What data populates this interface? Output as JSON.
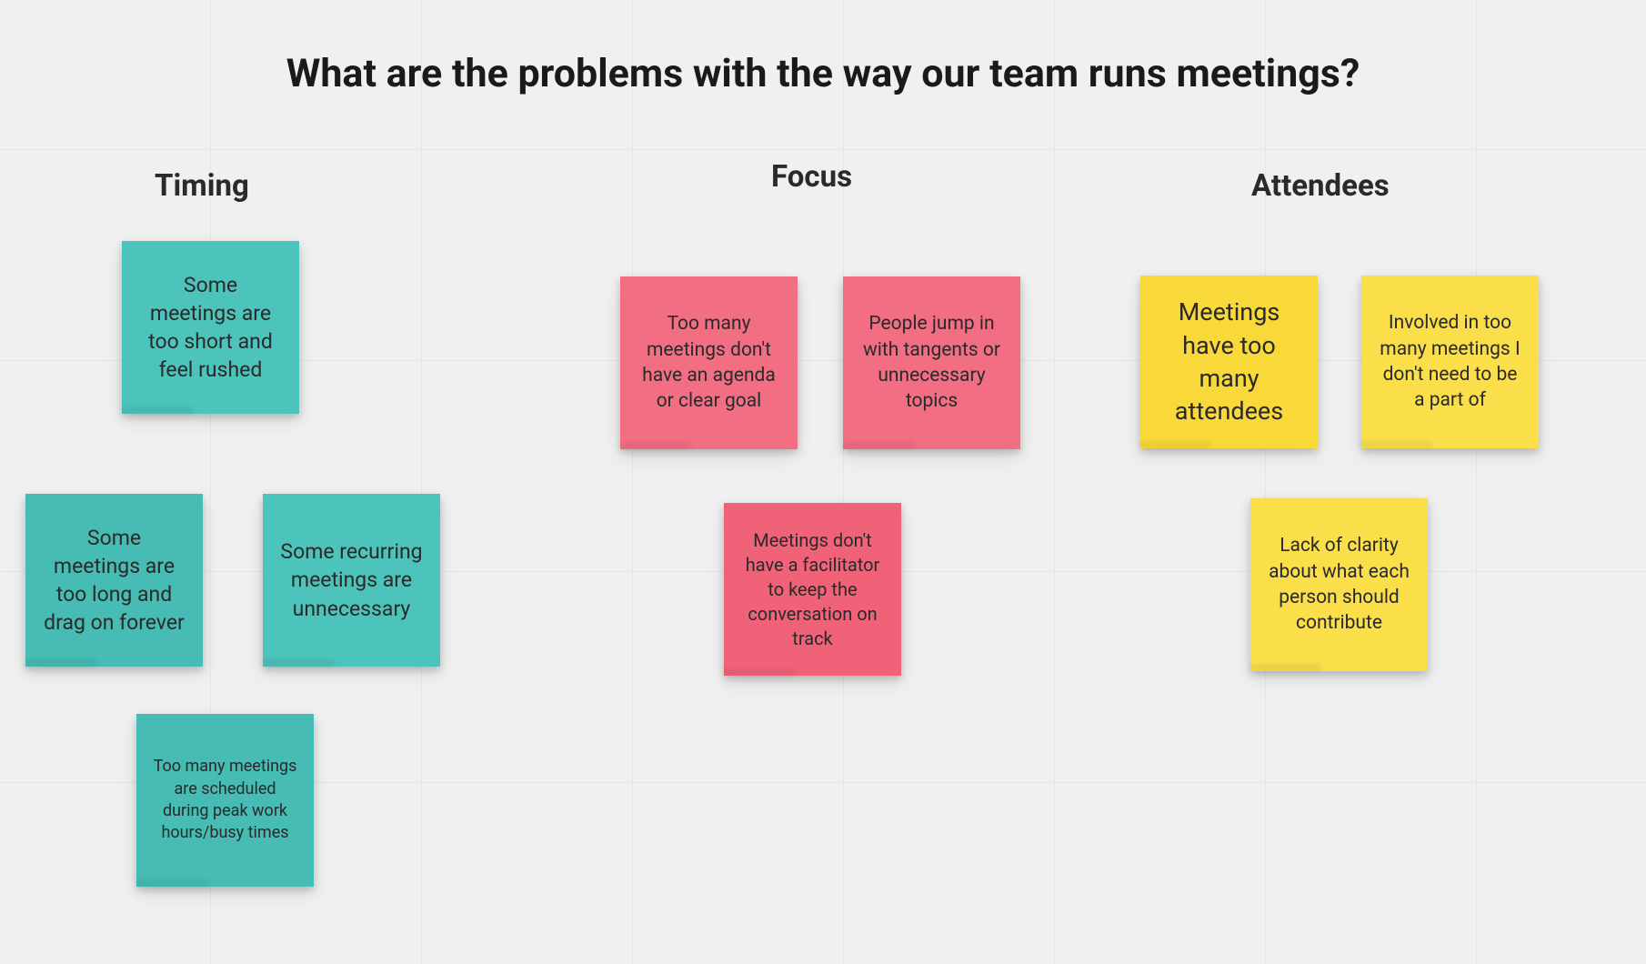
{
  "title": "What are the problems with the way our team runs meetings?",
  "clusters": {
    "timing": {
      "heading": "Timing",
      "notes": [
        "Some meetings are too short and feel rushed",
        "Some meetings are too long and drag on forever",
        "Some recurring meetings are unnecessary",
        "Too many meetings are scheduled during peak work hours/busy times"
      ]
    },
    "focus": {
      "heading": "Focus",
      "notes": [
        "Too many meetings don't have an agenda or clear goal",
        "People jump in with tangents or unnecessary topics",
        "Meetings don't have a facilitator to keep the conversation on track"
      ]
    },
    "attendees": {
      "heading": "Attendees",
      "notes": [
        "Meetings have too many attendees",
        "Involved in too many meetings I don't need to be a part of",
        "Lack of clarity about what each person should contribute"
      ]
    }
  },
  "colors": {
    "teal": "#4cc3bb",
    "pink": "#f06278",
    "yellow": "#f9d93a",
    "background": "#f0f0f0",
    "grid": "#e5e5e5"
  }
}
